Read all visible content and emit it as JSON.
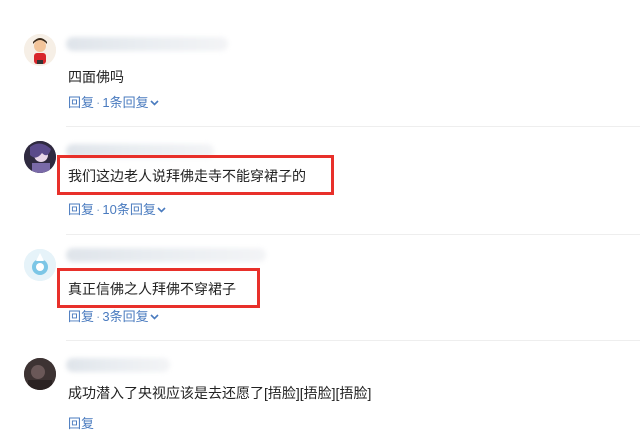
{
  "comments": [
    {
      "text": "四面佛吗",
      "reply_label": "回复",
      "separator": "·",
      "replies_count_label": "1条回复",
      "highlighted": false
    },
    {
      "text": "我们这边老人说拜佛走寺不能穿裙子的",
      "reply_label": "回复",
      "separator": "·",
      "replies_count_label": "10条回复",
      "highlighted": true
    },
    {
      "text": "真正信佛之人拜佛不穿裙子",
      "reply_label": "回复",
      "separator": "·",
      "replies_count_label": "3条回复",
      "highlighted": true
    },
    {
      "text": "成功潜入了央视应该是去还愿了[捂脸][捂脸][捂脸]",
      "reply_label": "回复",
      "highlighted": false
    }
  ],
  "colors": {
    "link": "#4a7bbf",
    "highlight_border": "#e8302a",
    "text": "#222222"
  },
  "icons": {
    "expand": "chevron-down-icon"
  }
}
